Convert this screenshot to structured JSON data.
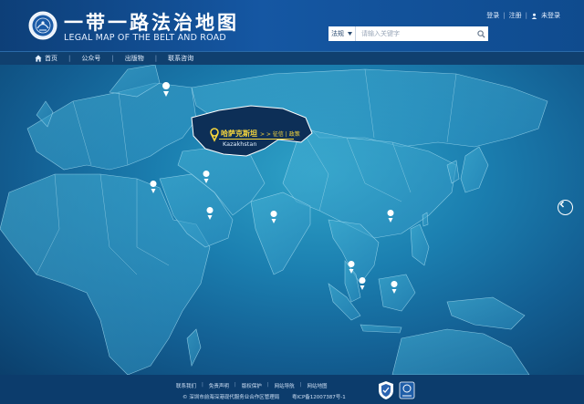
{
  "header": {
    "title_cn": "一带一路法治地图",
    "title_en": "LEGAL MAP OF THE BELT AND ROAD"
  },
  "user_links": {
    "login": "登录",
    "register": "注册",
    "status": "未登录"
  },
  "search": {
    "category": "法规",
    "placeholder": "请输入关键字"
  },
  "nav": {
    "items": [
      "首页",
      "公众号",
      "出版物",
      "联系咨询"
    ]
  },
  "map": {
    "selected_country_cn": "哈萨克斯坦",
    "selected_country_en": "Kazakhstan",
    "selected_links": "> > 征信 | 政策",
    "highlight_color": "#0d2f57",
    "pin_color": "#ffffff",
    "active_pin_color": "#f7d63c"
  },
  "footer": {
    "links": [
      "联系我们",
      "免责声明",
      "版权保护",
      "网站导航",
      "网站地图"
    ],
    "copyright": "© 深圳市前海深港现代服务业合作区管理局",
    "icp": "粤ICP备12007387号-1"
  }
}
